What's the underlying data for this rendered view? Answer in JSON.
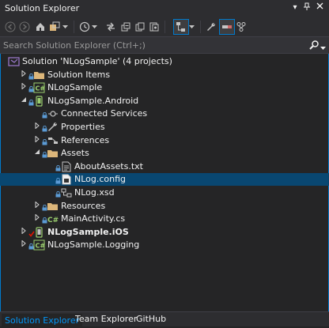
{
  "window": {
    "title": "Solution Explorer",
    "pin_icon": "dropdown-arrow",
    "pushpin_icon": "pin",
    "close_icon": "close"
  },
  "toolbar": {
    "buttons": [
      "back-icon",
      "forward-icon",
      "home-icon",
      "dropdown-icon",
      "history-icon",
      "sync-icon",
      "collapse-all-icon",
      "show-all-files-icon",
      "refresh-icon",
      "preview-selected-icon",
      "properties-icon",
      "pending-changes-icon",
      "solution-tree-icon"
    ]
  },
  "search": {
    "placeholder": "Search Solution Explorer (Ctrl+;)"
  },
  "tree": [
    {
      "label": "Solution 'NLogSample' (4 projects)",
      "level": 0,
      "expander": "",
      "icon": "solution-icon"
    },
    {
      "label": "Solution Items",
      "level": 1,
      "expander": "collapsed",
      "icon": "folder-icon"
    },
    {
      "label": "NLogSample",
      "level": 1,
      "expander": "collapsed",
      "icon": "csharp-project-icon"
    },
    {
      "label": "NLogSample.Android",
      "level": 1,
      "expander": "expanded",
      "icon": "android-project-icon"
    },
    {
      "label": "Connected Services",
      "level": 2,
      "expander": "",
      "icon": "connected-services-icon"
    },
    {
      "label": "Properties",
      "level": 2,
      "expander": "collapsed",
      "icon": "wrench-icon"
    },
    {
      "label": "References",
      "level": 2,
      "expander": "collapsed",
      "icon": "references-icon"
    },
    {
      "label": "Assets",
      "level": 2,
      "expander": "expanded",
      "icon": "folder-icon"
    },
    {
      "label": "AboutAssets.txt",
      "level": 3,
      "expander": "",
      "icon": "text-file-icon"
    },
    {
      "label": "NLog.config",
      "level": 3,
      "expander": "",
      "icon": "config-file-icon",
      "selected": true
    },
    {
      "label": "NLog.xsd",
      "level": 3,
      "expander": "",
      "icon": "xsd-file-icon"
    },
    {
      "label": "Resources",
      "level": 2,
      "expander": "collapsed",
      "icon": "folder-icon"
    },
    {
      "label": "MainActivity.cs",
      "level": 2,
      "expander": "collapsed",
      "icon": "csharp-file-icon"
    },
    {
      "label": "NLogSample.iOS",
      "level": 1,
      "expander": "collapsed",
      "icon": "ios-project-icon",
      "bold": true
    },
    {
      "label": "NLogSample.Logging",
      "level": 1,
      "expander": "collapsed",
      "icon": "csharp-project-icon"
    }
  ],
  "tabs": [
    {
      "label": "Solution Explorer",
      "active": true
    },
    {
      "label": "Team Explorer",
      "active": false
    },
    {
      "label": "GitHub",
      "active": false
    }
  ],
  "colors": {
    "accent": "#007acc",
    "selection": "#094771",
    "folder": "#dcb67a",
    "csharp": "#68217a"
  }
}
